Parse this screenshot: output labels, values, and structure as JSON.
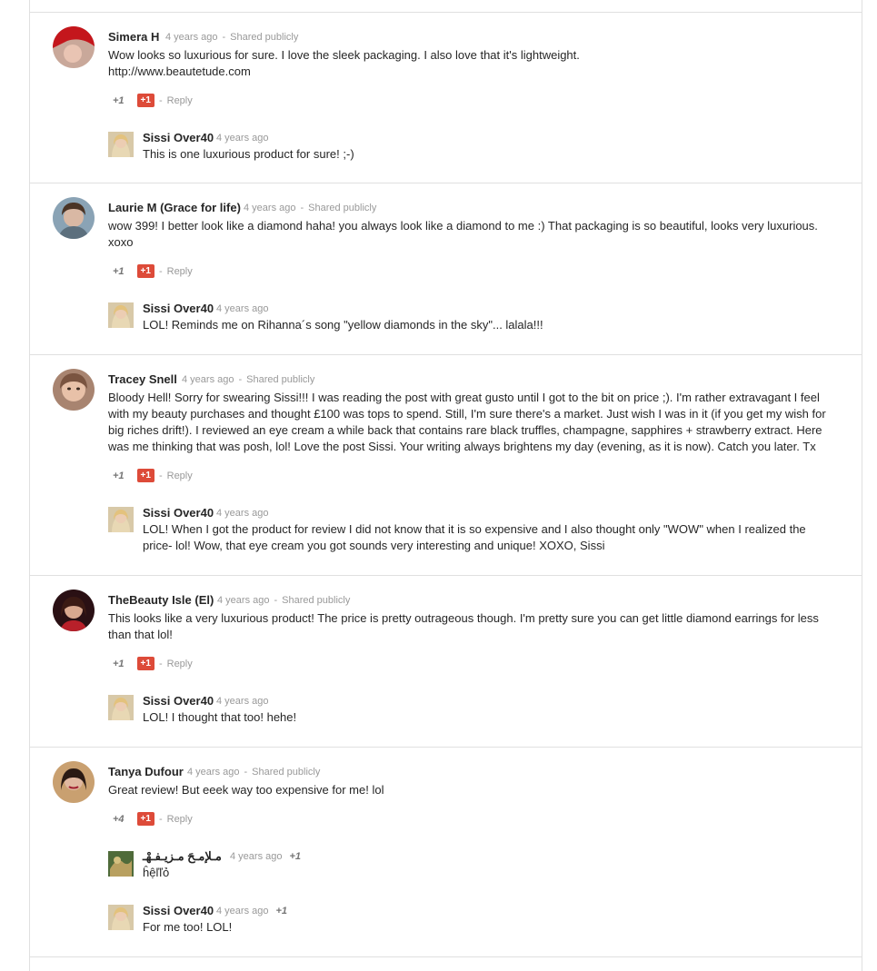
{
  "shared_label": "Shared publicly",
  "reply_label": "Reply",
  "plus_button": "+1",
  "threads": [
    {
      "author": "Simera H",
      "time": "4 years ago",
      "text": "Wow looks so luxurious for sure. I love the sleek packaging. I also love that it's lightweight.",
      "text2": "http://www.beautetude.com",
      "plus_count": "+1",
      "replies": [
        {
          "author": "Sissi Over40",
          "time": "4 years ago",
          "text": "This is one luxurious product for sure! ;-)"
        }
      ]
    },
    {
      "author": "Laurie M (Grace for life)",
      "time": "4 years ago",
      "text": "wow 399! I better look like a diamond haha! you always look like a diamond to me :) That packaging is so beautiful, looks very luxurious. xoxo",
      "plus_count": "+1",
      "replies": [
        {
          "author": "Sissi Over40",
          "time": "4 years ago",
          "text": "LOL! Reminds me on Rihanna´s song \"yellow diamonds in the sky\"... lalala!!!"
        }
      ]
    },
    {
      "author": "Tracey Snell",
      "time": "4 years ago",
      "text": "Bloody Hell! Sorry for swearing Sissi!!! I was reading the post with great gusto until I got to the bit on price ;). I'm rather extravagant I feel with my beauty purchases and thought £100 was tops to spend. Still, I'm sure there's a market. Just wish I was in it (if you get my wish for big riches drift!). I reviewed an eye cream a while back that contains rare black truffles, champagne, sapphires + strawberry extract. Here was me thinking that was posh, lol! Love the post Sissi. Your writing always brightens my day (evening, as it is now). Catch you later. Tx",
      "plus_count": "+1",
      "replies": [
        {
          "author": "Sissi Over40",
          "time": "4 years ago",
          "text": "LOL! When I got the product for review I did not know that it is so expensive and I also thought only \"WOW\" when I realized the price- lol! Wow, that eye cream you got sounds very interesting and unique! XOXO, Sissi"
        }
      ]
    },
    {
      "author": "TheBeauty Isle (El)",
      "time": "4 years ago",
      "text": "This looks like a very luxurious product!  The price is pretty outrageous though.  I'm pretty sure you can get little diamond earrings for less than that lol!",
      "plus_count": "+1",
      "replies": [
        {
          "author": "Sissi Over40",
          "time": "4 years ago",
          "text": "LOL! I thought that too! hehe!"
        }
      ]
    },
    {
      "author": "Tanya Dufour",
      "time": "4 years ago",
      "text": "Great review! But eeek way too expensive for me! lol",
      "plus_count": "+4",
      "replies": [
        {
          "author": "مـلإمـحَ مـزيـفـهْـ",
          "time": "4 years ago",
          "plus": "+1",
          "text": "ĥệľľỏ"
        },
        {
          "author": "Sissi Over40",
          "time": "4 years ago",
          "plus": "+1",
          "text": "For me too! LOL!"
        }
      ]
    }
  ]
}
